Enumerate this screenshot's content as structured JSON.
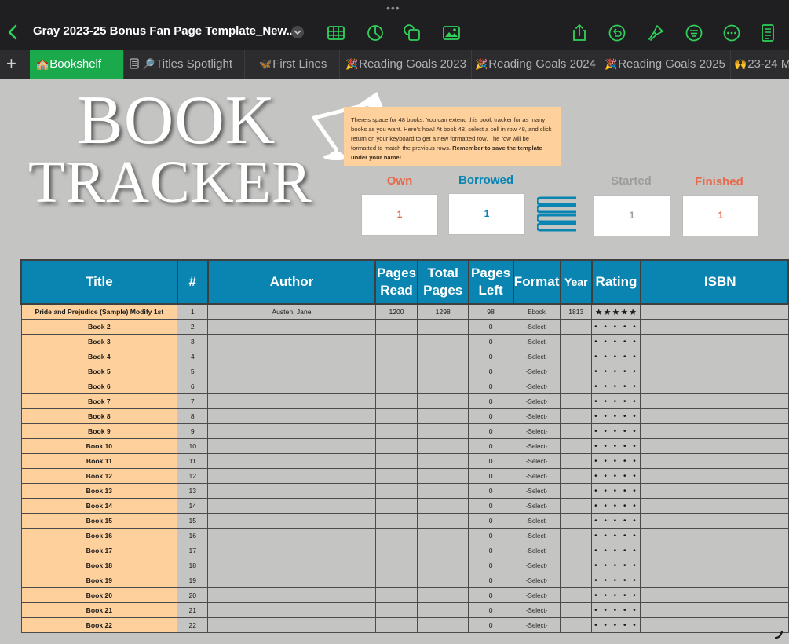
{
  "toolbar": {
    "document_title": "Gray 2023-25 Bonus Fan Page Template_New...",
    "grabber": "•••"
  },
  "tabs": [
    {
      "label": "Bookshelf",
      "emoji": "🏫",
      "active": true
    },
    {
      "label": "Titles Spotlight",
      "emoji": "🔎",
      "active": false
    },
    {
      "label": "First Lines",
      "emoji": "🦋",
      "active": false
    },
    {
      "label": "Reading Goals 2023",
      "emoji": "🎉",
      "active": false
    },
    {
      "label": "Reading Goals 2024",
      "emoji": "🎉",
      "active": false
    },
    {
      "label": "Reading Goals 2025",
      "emoji": "🎉",
      "active": false
    },
    {
      "label": "23-24 M",
      "emoji": "🙌",
      "active": false
    }
  ],
  "sheet": {
    "title_line1": "BOOK",
    "title_line2": "TRACKER",
    "note_text": "There's space for 48 books. You can extend this book tracker for as many books as you want. Here's how! At book 48, select a cell in row 48, and click return on your keyboard to get a new formatted row. The row will be formatted to match the previous rows.",
    "note_bold": "Remember to save the template under your name!",
    "stats": [
      {
        "label": "Own",
        "value": "1",
        "color": "#e8684a"
      },
      {
        "label": "Borrowed",
        "value": "1",
        "color": "#0a85b2"
      },
      {
        "label": "Started",
        "value": "1",
        "color": "#9c9c9c"
      },
      {
        "label": "Finished",
        "value": "1",
        "color": "#e8684a"
      }
    ],
    "colors": {
      "header_blue": "#0a85b2",
      "title_peach": "#fdd09c",
      "accent_green": "#1aa94b"
    }
  },
  "table": {
    "headers": [
      "Title",
      "#",
      "Author",
      "Pages Read",
      "Total Pages",
      "Pages Left",
      "Format",
      "Year",
      "Rating",
      "ISBN"
    ],
    "rows": [
      {
        "title": "Pride and Prejudice (Sample) Modify 1st",
        "num": "1",
        "author": "Austen, Jane",
        "pages_read": "1200",
        "total_pages": "1298",
        "pages_left": "98",
        "format": "Ebook",
        "year": "1813",
        "rating": "★★★★★",
        "isbn": ""
      },
      {
        "title": "Book 2",
        "num": "2",
        "author": "",
        "pages_read": "",
        "total_pages": "",
        "pages_left": "0",
        "format": "-Select-",
        "year": "",
        "rating": "• • • • •",
        "isbn": ""
      },
      {
        "title": "Book 3",
        "num": "3",
        "author": "",
        "pages_read": "",
        "total_pages": "",
        "pages_left": "0",
        "format": "-Select-",
        "year": "",
        "rating": "• • • • •",
        "isbn": ""
      },
      {
        "title": "Book 4",
        "num": "4",
        "author": "",
        "pages_read": "",
        "total_pages": "",
        "pages_left": "0",
        "format": "-Select-",
        "year": "",
        "rating": "• • • • •",
        "isbn": ""
      },
      {
        "title": "Book 5",
        "num": "5",
        "author": "",
        "pages_read": "",
        "total_pages": "",
        "pages_left": "0",
        "format": "-Select-",
        "year": "",
        "rating": "• • • • •",
        "isbn": ""
      },
      {
        "title": "Book 6",
        "num": "6",
        "author": "",
        "pages_read": "",
        "total_pages": "",
        "pages_left": "0",
        "format": "-Select-",
        "year": "",
        "rating": "• • • • •",
        "isbn": ""
      },
      {
        "title": "Book 7",
        "num": "7",
        "author": "",
        "pages_read": "",
        "total_pages": "",
        "pages_left": "0",
        "format": "-Select-",
        "year": "",
        "rating": "• • • • •",
        "isbn": ""
      },
      {
        "title": "Book 8",
        "num": "8",
        "author": "",
        "pages_read": "",
        "total_pages": "",
        "pages_left": "0",
        "format": "-Select-",
        "year": "",
        "rating": "• • • • •",
        "isbn": ""
      },
      {
        "title": "Book 9",
        "num": "9",
        "author": "",
        "pages_read": "",
        "total_pages": "",
        "pages_left": "0",
        "format": "-Select-",
        "year": "",
        "rating": "• • • • •",
        "isbn": ""
      },
      {
        "title": "Book 10",
        "num": "10",
        "author": "",
        "pages_read": "",
        "total_pages": "",
        "pages_left": "0",
        "format": "-Select-",
        "year": "",
        "rating": "• • • • •",
        "isbn": ""
      },
      {
        "title": "Book 11",
        "num": "11",
        "author": "",
        "pages_read": "",
        "total_pages": "",
        "pages_left": "0",
        "format": "-Select-",
        "year": "",
        "rating": "• • • • •",
        "isbn": ""
      },
      {
        "title": "Book 12",
        "num": "12",
        "author": "",
        "pages_read": "",
        "total_pages": "",
        "pages_left": "0",
        "format": "-Select-",
        "year": "",
        "rating": "• • • • •",
        "isbn": ""
      },
      {
        "title": "Book 13",
        "num": "13",
        "author": "",
        "pages_read": "",
        "total_pages": "",
        "pages_left": "0",
        "format": "-Select-",
        "year": "",
        "rating": "• • • • •",
        "isbn": ""
      },
      {
        "title": "Book 14",
        "num": "14",
        "author": "",
        "pages_read": "",
        "total_pages": "",
        "pages_left": "0",
        "format": "-Select-",
        "year": "",
        "rating": "• • • • •",
        "isbn": ""
      },
      {
        "title": "Book 15",
        "num": "15",
        "author": "",
        "pages_read": "",
        "total_pages": "",
        "pages_left": "0",
        "format": "-Select-",
        "year": "",
        "rating": "• • • • •",
        "isbn": ""
      },
      {
        "title": "Book 16",
        "num": "16",
        "author": "",
        "pages_read": "",
        "total_pages": "",
        "pages_left": "0",
        "format": "-Select-",
        "year": "",
        "rating": "• • • • •",
        "isbn": ""
      },
      {
        "title": "Book 17",
        "num": "17",
        "author": "",
        "pages_read": "",
        "total_pages": "",
        "pages_left": "0",
        "format": "-Select-",
        "year": "",
        "rating": "• • • • •",
        "isbn": ""
      },
      {
        "title": "Book 18",
        "num": "18",
        "author": "",
        "pages_read": "",
        "total_pages": "",
        "pages_left": "0",
        "format": "-Select-",
        "year": "",
        "rating": "• • • • •",
        "isbn": ""
      },
      {
        "title": "Book 19",
        "num": "19",
        "author": "",
        "pages_read": "",
        "total_pages": "",
        "pages_left": "0",
        "format": "-Select-",
        "year": "",
        "rating": "• • • • •",
        "isbn": ""
      },
      {
        "title": "Book 20",
        "num": "20",
        "author": "",
        "pages_read": "",
        "total_pages": "",
        "pages_left": "0",
        "format": "-Select-",
        "year": "",
        "rating": "• • • • •",
        "isbn": ""
      },
      {
        "title": "Book 21",
        "num": "21",
        "author": "",
        "pages_read": "",
        "total_pages": "",
        "pages_left": "0",
        "format": "-Select-",
        "year": "",
        "rating": "• • • • •",
        "isbn": ""
      },
      {
        "title": "Book 22",
        "num": "22",
        "author": "",
        "pages_read": "",
        "total_pages": "",
        "pages_left": "0",
        "format": "-Select-",
        "year": "",
        "rating": "• • • • •",
        "isbn": ""
      }
    ]
  }
}
